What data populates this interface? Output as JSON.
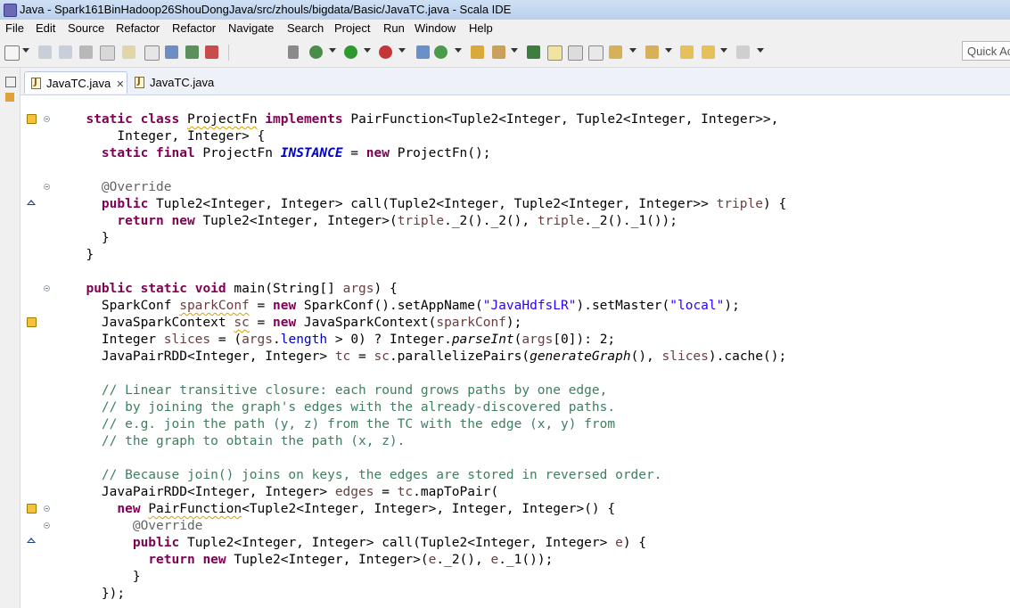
{
  "window": {
    "title": "Java - Spark161BinHadoop26ShouDongJava/src/zhouls/bigdata/Basic/JavaTC.java - Scala IDE"
  },
  "menu": [
    "File",
    "Edit",
    "Source",
    "Refactor",
    "Refactor",
    "Navigate",
    "Search",
    "Project",
    "Run",
    "Window",
    "Help"
  ],
  "toolbar": {
    "quick_access_placeholder": "Quick Ac"
  },
  "tabs": [
    {
      "label": "JavaTC.java",
      "active": true,
      "closable": true
    },
    {
      "label": "JavaTC.java",
      "active": false,
      "closable": false
    }
  ],
  "editor": {
    "lines": [
      "  static class ProjectFn implements PairFunction<Tuple2<Integer, Tuple2<Integer, Integer>>,",
      "      Integer, Integer> {",
      "    static final ProjectFn INSTANCE = new ProjectFn();",
      "",
      "    @Override",
      "    public Tuple2<Integer, Integer> call(Tuple2<Integer, Tuple2<Integer, Integer>> triple) {",
      "      return new Tuple2<Integer, Integer>(triple._2()._2(), triple._2()._1());",
      "    }",
      "  }",
      "",
      "  public static void main(String[] args) {",
      "    SparkConf sparkConf = new SparkConf().setAppName(\"JavaHdfsLR\").setMaster(\"local\");",
      "    JavaSparkContext sc = new JavaSparkContext(sparkConf);",
      "    Integer slices = (args.length > 0) ? Integer.parseInt(args[0]): 2;",
      "    JavaPairRDD<Integer, Integer> tc = sc.parallelizePairs(generateGraph(), slices).cache();",
      "",
      "    // Linear transitive closure: each round grows paths by one edge,",
      "    // by joining the graph's edges with the already-discovered paths.",
      "    // e.g. join the path (y, z) from the TC with the edge (x, y) from",
      "    // the graph to obtain the path (x, z).",
      "",
      "    // Because join() joins on keys, the edges are stored in reversed order.",
      "    JavaPairRDD<Integer, Integer> edges = tc.mapToPair(",
      "      new PairFunction<Tuple2<Integer, Integer>, Integer, Integer>() {",
      "        @Override",
      "        public Tuple2<Integer, Integer> call(Tuple2<Integer, Integer> e) {",
      "          return new Tuple2<Integer, Integer>(e._2(), e._1());",
      "        }",
      "    });"
    ]
  },
  "colors": {
    "keyword": "#7f0055",
    "string": "#2a00ff",
    "comment": "#3f7f5f",
    "annotation": "#646464",
    "field": "#0000c0"
  }
}
